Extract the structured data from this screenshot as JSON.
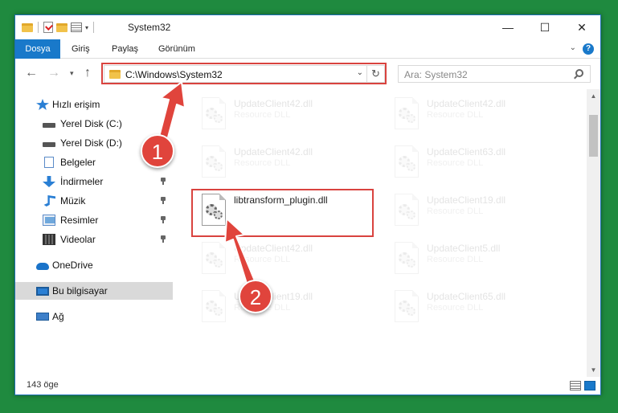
{
  "window": {
    "title": "System32",
    "controls": {
      "minimize": "—",
      "maximize": "☐",
      "close": "✕"
    }
  },
  "ribbon": {
    "tabs": [
      {
        "label": "Dosya",
        "active": true
      },
      {
        "label": "Giriş"
      },
      {
        "label": "Paylaş"
      },
      {
        "label": "Görünüm"
      }
    ],
    "help": "?"
  },
  "address": {
    "path": "C:\\Windows\\System32",
    "search_placeholder": "Ara: System32"
  },
  "sidebar": {
    "quick_access": "Hızlı erişim",
    "items": [
      {
        "label": "Yerel Disk (C:)",
        "icon": "drive-icon",
        "pinned": false
      },
      {
        "label": "Yerel Disk (D:)",
        "icon": "drive-icon",
        "pinned": false
      },
      {
        "label": "Belgeler",
        "icon": "documents-icon",
        "pinned": true
      },
      {
        "label": "İndirmeler",
        "icon": "downloads-icon",
        "pinned": true
      },
      {
        "label": "Müzik",
        "icon": "music-icon",
        "pinned": true
      },
      {
        "label": "Resimler",
        "icon": "pictures-icon",
        "pinned": true
      },
      {
        "label": "Videolar",
        "icon": "videos-icon",
        "pinned": true
      }
    ],
    "onedrive": "OneDrive",
    "this_pc": "Bu bilgisayar",
    "network": "Ağ"
  },
  "files": [
    {
      "name": "UpdateClient42.dll",
      "type": "Resource DLL",
      "faded": true
    },
    {
      "name": "UpdateClient42.dll",
      "type": "Resource DLL",
      "faded": true
    },
    {
      "name": "UpdateClient42.dll",
      "type": "Resource DLL",
      "faded": true
    },
    {
      "name": "UpdateClient63.dll",
      "type": "Resource DLL",
      "faded": true
    },
    {
      "name": "libtransform_plugin.dll",
      "type": "",
      "faded": false
    },
    {
      "name": "UpdateClient19.dll",
      "type": "Resource DLL",
      "faded": true
    },
    {
      "name": "UpdateClient42.dll",
      "type": "Resource DLL",
      "faded": true
    },
    {
      "name": "UpdateClient5.dll",
      "type": "Resource DLL",
      "faded": true
    },
    {
      "name": "UpdateClient19.dll",
      "type": "Resource DLL",
      "faded": true
    },
    {
      "name": "UpdateClient65.dll",
      "type": "Resource DLL",
      "faded": true
    }
  ],
  "status": {
    "item_count": "143 öge"
  },
  "annotations": {
    "step1": "1",
    "step2": "2",
    "accent": "#e0443c"
  },
  "colors": {
    "desktop": "#1f8a3f",
    "ribbon_file_tab": "#1979ca",
    "selection": "#d9d9d9"
  }
}
